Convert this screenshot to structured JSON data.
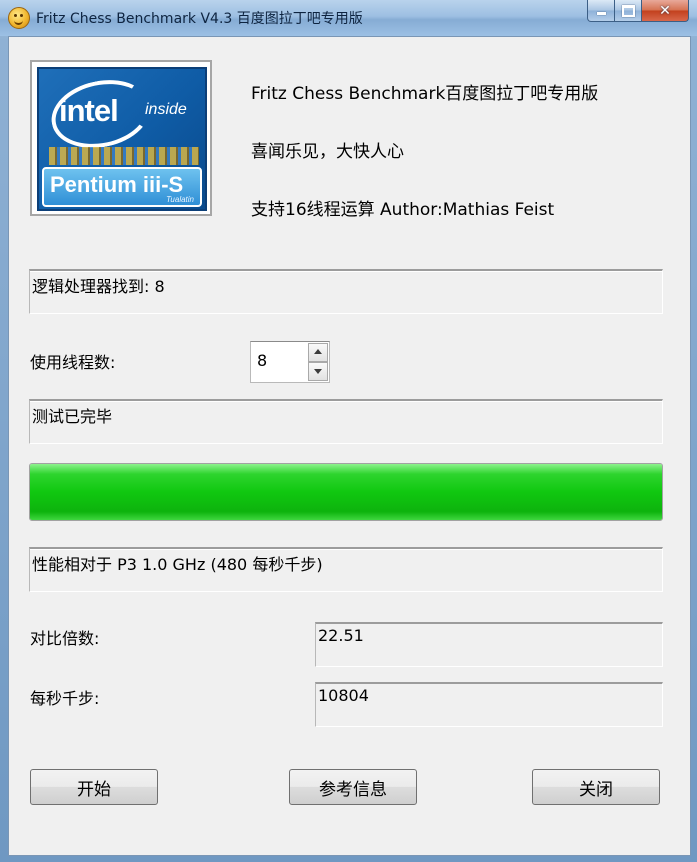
{
  "window": {
    "title": "Fritz Chess Benchmark V4.3   百度图拉丁吧专用版"
  },
  "logo": {
    "brand": "intel",
    "inside": "inside",
    "product": "Pentium iii-S",
    "codename": "Tualatin"
  },
  "info": {
    "line1": "Fritz Chess Benchmark百度图拉丁吧专用版",
    "line2": "喜闻乐见，大快人心",
    "line3": "支持16线程运算   Author:Mathias Feist"
  },
  "processors": {
    "text": "逻辑处理器找到: 8"
  },
  "threads": {
    "label": "使用线程数:",
    "value": "8"
  },
  "status": {
    "text": "测试已完毕"
  },
  "progress": {
    "fraction": 1.0
  },
  "performance": {
    "text": "性能相对于 P3 1.0 GHz (480 每秒千步)"
  },
  "ratio": {
    "label": "对比倍数:",
    "value": "22.51"
  },
  "kps": {
    "label": "每秒千步:",
    "value": "10804"
  },
  "buttons": {
    "start": "开始",
    "info": "参考信息",
    "close": "关闭"
  },
  "colors": {
    "progress_green": "#10c810",
    "title_bar": "#9dbfe2"
  }
}
